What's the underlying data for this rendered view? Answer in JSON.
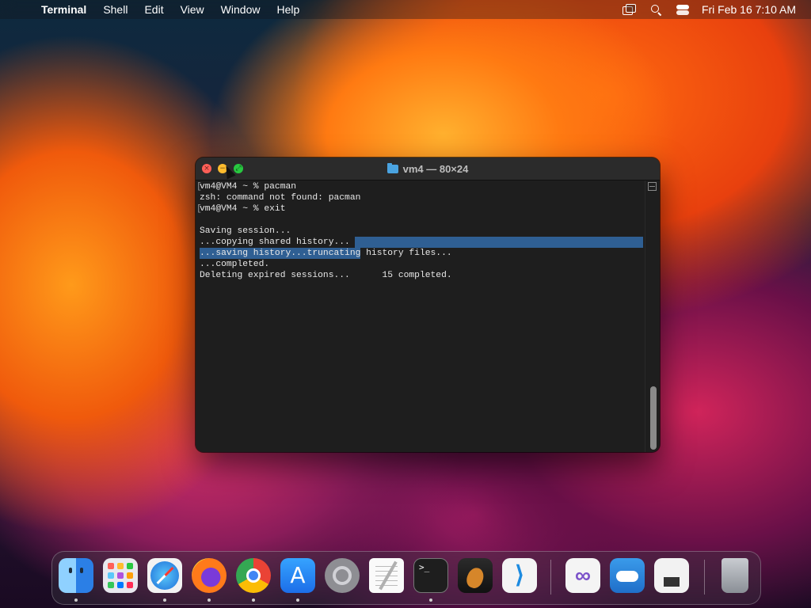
{
  "menubar": {
    "app_name": "Terminal",
    "items": [
      "Shell",
      "Edit",
      "View",
      "Window",
      "Help"
    ],
    "clock": "Fri Feb 16  7:10 AM"
  },
  "window": {
    "title": "vm4 — 80×24",
    "lines": [
      "vm4@VM4 ~ % pacman",
      "zsh: command not found: pacman",
      "vm4@VM4 ~ % exit",
      "",
      "Saving session...",
      "...copying shared history...",
      "...saving history...truncating history files...",
      "...completed.",
      "Deleting expired sessions...      15 completed."
    ]
  },
  "dock": {
    "apps": [
      "finder",
      "launchpad",
      "safari",
      "firefox",
      "chrome",
      "app-store",
      "system-settings",
      "textedit",
      "terminal",
      "garageband",
      "vscode",
      "visual-studio",
      "weather",
      "system-information",
      "trash"
    ]
  },
  "colors": {
    "selection": "#2f5f93",
    "terminal_bg": "#1e1e1e",
    "close": "#ff5f57",
    "minimize": "#febc2e",
    "zoom": "#28c840"
  }
}
